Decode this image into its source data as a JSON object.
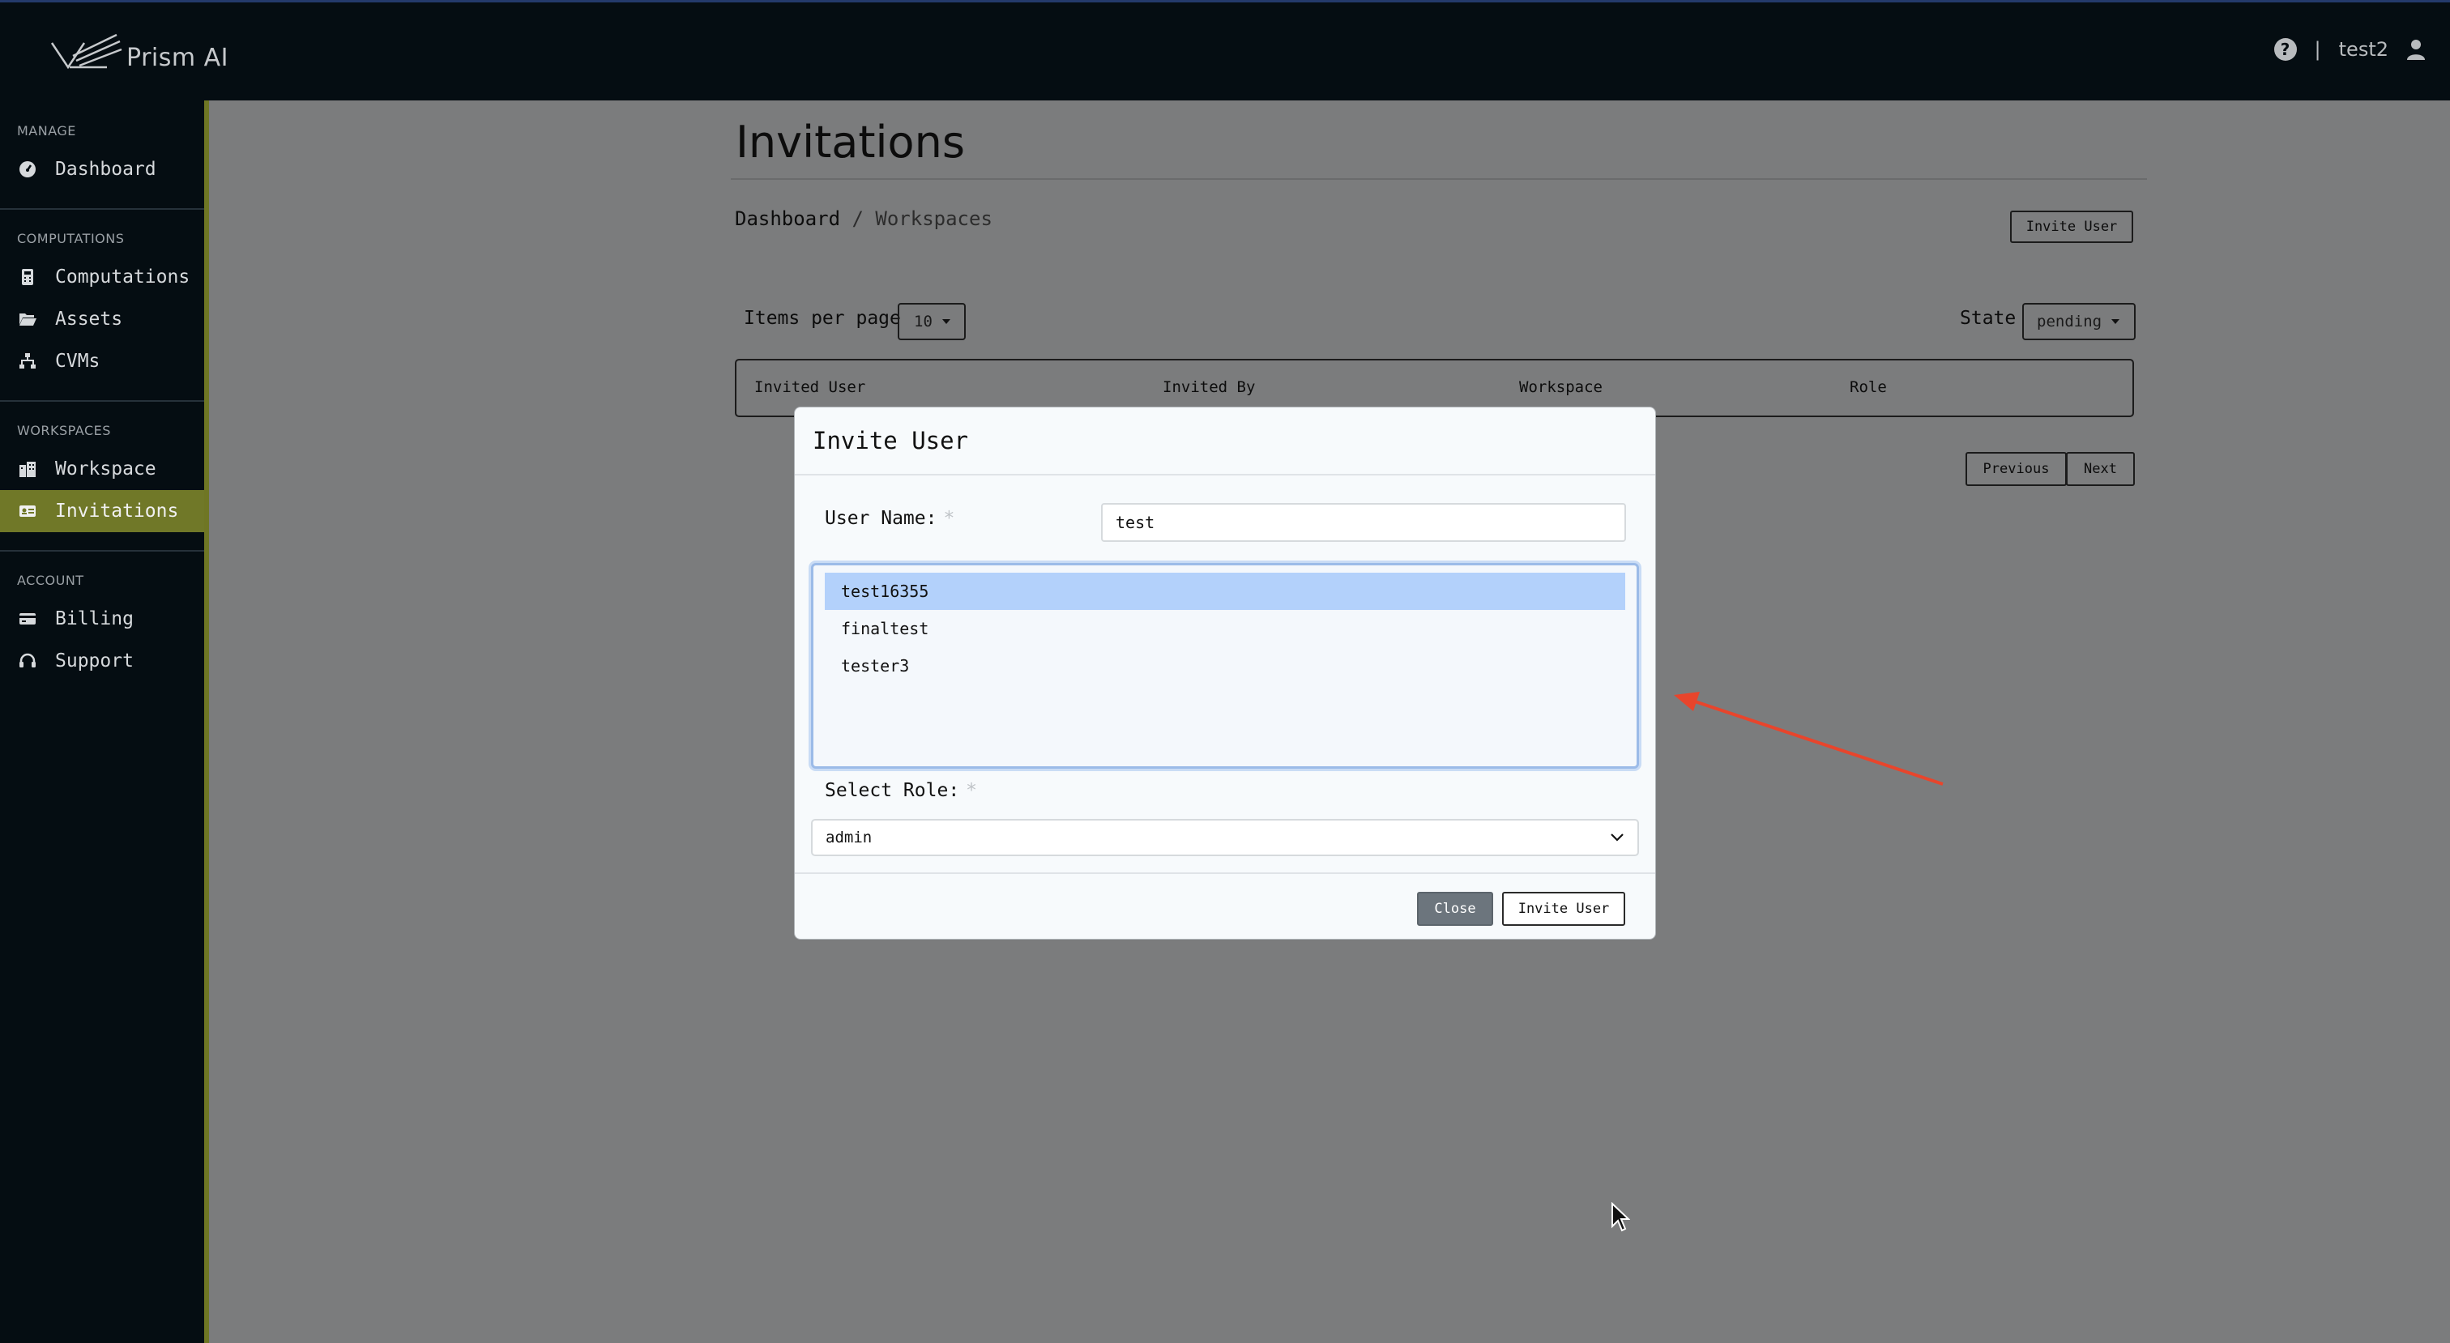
{
  "app": {
    "brand": "Prism AI"
  },
  "header": {
    "separator": "|",
    "username": "test2"
  },
  "sidebar": {
    "sections": [
      {
        "heading": "MANAGE",
        "items": [
          {
            "label": "Dashboard",
            "icon": "gauge-icon"
          }
        ]
      },
      {
        "heading": "COMPUTATIONS",
        "items": [
          {
            "label": "Computations",
            "icon": "calculator-icon"
          },
          {
            "label": "Assets",
            "icon": "folder-open-icon"
          },
          {
            "label": "CVMs",
            "icon": "sitemap-icon"
          }
        ]
      },
      {
        "heading": "WORKSPACES",
        "items": [
          {
            "label": "Workspace",
            "icon": "building-icon"
          },
          {
            "label": "Invitations",
            "icon": "id-card-icon",
            "active": true
          }
        ]
      },
      {
        "heading": "ACCOUNT",
        "items": [
          {
            "label": "Billing",
            "icon": "credit-card-icon"
          },
          {
            "label": "Support",
            "icon": "headset-icon"
          }
        ]
      }
    ]
  },
  "page": {
    "title": "Invitations",
    "breadcrumb": {
      "root": "Dashboard",
      "separator": "/",
      "current": "Workspaces"
    },
    "invite_button": "Invite User",
    "items_per_page_label": "Items per page",
    "items_per_page_value": "10",
    "state_label": "State",
    "state_value": "pending",
    "table_columns": [
      "Invited User",
      "Invited By",
      "Workspace",
      "Role"
    ],
    "previous_label": "Previous",
    "next_label": "Next"
  },
  "modal": {
    "title": "Invite User",
    "username_label": "User Name:",
    "required_mark": "*",
    "username_value": "test",
    "user_options": [
      "test16355",
      "finaltest",
      "tester3"
    ],
    "selected_option": "test16355",
    "role_label": "Select Role:",
    "role_value": "admin",
    "close_label": "Close",
    "invite_label": "Invite User"
  },
  "colors": {
    "sidebar_active": "#707828",
    "annotation_arrow": "#e8452c",
    "selected_option": "#b3d1fb",
    "close_button": "#6c757d"
  }
}
